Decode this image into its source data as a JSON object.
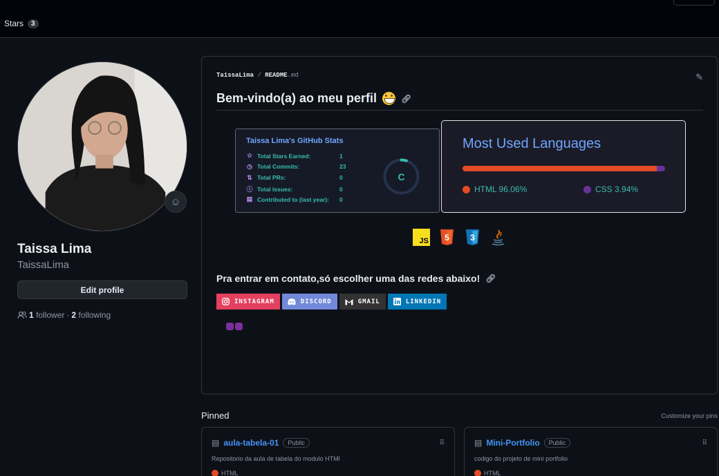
{
  "tabs": {
    "stars_label": "Stars",
    "stars_count": "3"
  },
  "profile": {
    "name": "Taissa Lima",
    "login": "TaissaLima",
    "edit_label": "Edit profile",
    "followers_count": "1",
    "followers_label": "follower",
    "separator": "·",
    "following_count": "2",
    "following_label": "following"
  },
  "readme": {
    "owner": "TaissaLima",
    "slash": "/",
    "file": "README",
    "ext": ".md",
    "heading": "Bem-vindo(a) ao meu perfil",
    "stats": {
      "title": "Taissa Lima's GitHub Stats",
      "rows": [
        {
          "icon": "star-icon",
          "label": "Total Stars Earned:",
          "value": "1"
        },
        {
          "icon": "clock-icon",
          "label": "Total Commits:",
          "value": "23"
        },
        {
          "icon": "pull-request-icon",
          "label": "Total PRs:",
          "value": "0"
        },
        {
          "icon": "issue-icon",
          "label": "Total Issues:",
          "value": "0"
        },
        {
          "icon": "repo-icon",
          "label": "Contributed to (last year):",
          "value": "0"
        }
      ],
      "grade": "C",
      "grade_progress": 0.05
    },
    "languages": {
      "title": "Most Used Languages",
      "items": [
        {
          "name": "HTML",
          "percent": 96.06,
          "label": "HTML 96.06%",
          "color": "#e34c26"
        },
        {
          "name": "CSS",
          "percent": 3.94,
          "label": "CSS 3.94%",
          "color": "#663399"
        }
      ]
    },
    "tech_icons": [
      {
        "name": "javascript-icon",
        "text": "JS",
        "color": "#f7df1e"
      },
      {
        "name": "html5-icon",
        "text": "5",
        "color": "#e34f26"
      },
      {
        "name": "css3-icon",
        "text": "3",
        "color": "#1572b6"
      },
      {
        "name": "java-icon",
        "text": "",
        "color": "#0073b7"
      }
    ],
    "contact_heading": "Pra entrar em contato,só escolher uma das redes abaixo!",
    "badges": [
      {
        "label": "INSTAGRAM",
        "color": "#e4405f",
        "icon": "instagram-icon"
      },
      {
        "label": "DISCORD",
        "color": "#7289da",
        "icon": "discord-icon"
      },
      {
        "label": "GMAIL",
        "color": "#333333",
        "icon": "gmail-icon"
      },
      {
        "label": "LINKEDIN",
        "color": "#0077b5",
        "icon": "linkedin-icon"
      }
    ]
  },
  "pinned": {
    "title": "Pinned",
    "customize": "Customize your pins",
    "repos": [
      {
        "name": "aula-tabela-01",
        "visibility": "Public",
        "description": "Repositorio da aula de tabela do modulo HTMl",
        "language": "HTML"
      },
      {
        "name": "Mini-Portfolio",
        "visibility": "Public",
        "description": "codigo do projeto de mini portfolio",
        "language": "HTML"
      }
    ]
  },
  "colors": {
    "accent": "#70a5fd",
    "teal": "#38bdae",
    "link": "#4493f8"
  }
}
